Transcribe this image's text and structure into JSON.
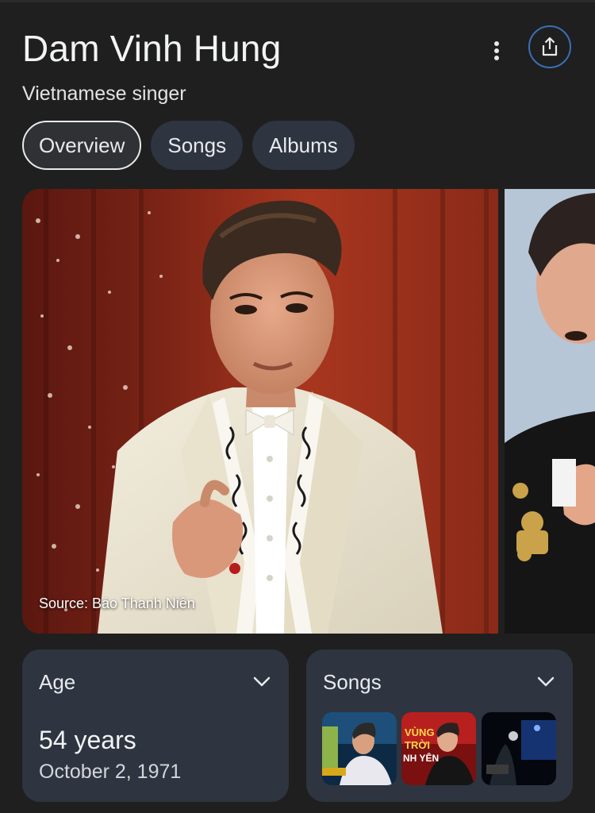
{
  "header": {
    "title": "Dam Vinh Hung",
    "subtitle": "Vietnamese singer",
    "more_icon": "more-vert-icon",
    "share_icon": "share-icon"
  },
  "tabs": [
    {
      "label": "Overview",
      "active": true
    },
    {
      "label": "Songs",
      "active": false
    },
    {
      "label": "Albums",
      "active": false
    }
  ],
  "images": {
    "source_label": "Source: Báo Thanh Niên"
  },
  "cards": {
    "age": {
      "title": "Age",
      "value": "54 years",
      "date": "October 2, 1971"
    },
    "songs": {
      "title": "Songs",
      "thumb_texts": [
        "VÙNG",
        "TRỜI",
        "NH YÊN"
      ]
    }
  },
  "colors": {
    "background": "#1f1f1f",
    "card": "#2e3440",
    "share_ring": "#3b6fb6"
  }
}
